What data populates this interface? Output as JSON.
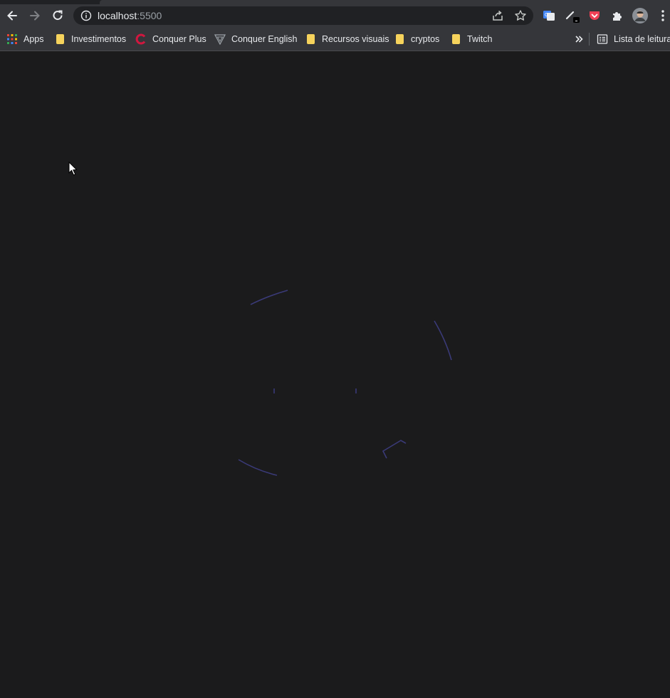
{
  "browser": {
    "url_host": "localhost",
    "url_port": ":5500"
  },
  "bookmarks": [
    {
      "label": "Apps",
      "icon": "apps-grid-icon"
    },
    {
      "label": "Investimentos",
      "icon": "folder-icon"
    },
    {
      "label": "Conquer Plus",
      "icon": "conquer-plus-icon"
    },
    {
      "label": "Conquer English",
      "icon": "conquer-english-icon"
    },
    {
      "label": "Recursos visuais",
      "icon": "folder-icon"
    },
    {
      "label": "cryptos",
      "icon": "folder-icon"
    },
    {
      "label": "Twitch",
      "icon": "folder-icon"
    }
  ],
  "reading_list": {
    "label": "Lista de leitura",
    "icon": "reading-list-icon"
  },
  "colors": {
    "page_background": "#1b1b1c",
    "chrome_toolbar": "#35363a",
    "stroke": "#3a3a78",
    "pocket": "#ef4056",
    "conquer": "#d0173f"
  }
}
